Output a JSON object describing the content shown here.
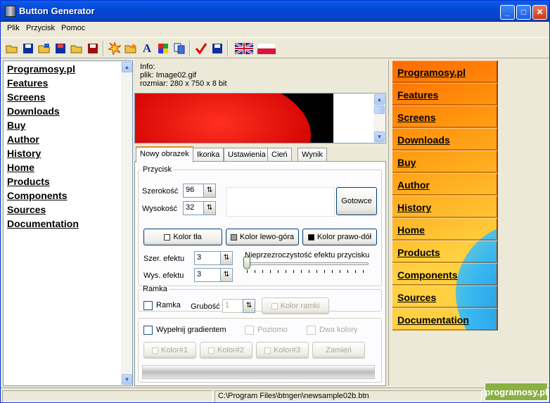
{
  "window": {
    "title": "Button Generator"
  },
  "menu": [
    "Plik",
    "Przycisk",
    "Pomoc"
  ],
  "links": [
    "Programosy.pl",
    "Features",
    "Screens",
    "Downloads",
    "Buy",
    "Author",
    "History",
    "Home",
    "Products",
    "Components",
    "Sources",
    "Documentation"
  ],
  "info": {
    "line1": "Info:",
    "line2": "plik: Image02.gif",
    "line3": "rozmiar: 280 x 750 x 8 bit"
  },
  "tabs": [
    "Nowy obrazek",
    "Ikonka",
    "Ustawienia",
    "Cień",
    "Wynik"
  ],
  "przycisk": {
    "legend": "Przycisk",
    "width_label": "Szerokość",
    "width_value": "96",
    "height_label": "Wysokość",
    "height_value": "32",
    "ready_btn": "Gotowce",
    "bg_color_btn": "Kolor tła",
    "tl_color_btn": "Kolor lewo-góra",
    "br_color_btn": "Kolor prawo-dół",
    "effect_w_label": "Szer. efektu",
    "effect_w_value": "3",
    "effect_h_label": "Wys. efektu",
    "effect_h_value": "3",
    "opacity_label": "Nieprzezroczystość efektu przycisku"
  },
  "ramka": {
    "legend": "Ramka",
    "chk_label": "Ramka",
    "thickness_label": "Grubość",
    "thickness_value": "1",
    "color_btn": "Kolor ramki"
  },
  "gradient": {
    "fill_label": "Wypełnij gradientem",
    "horiz_label": "Poziomo",
    "two_label": "Dwa kolory",
    "c1": "Kolor#1",
    "c2": "Kolor#2",
    "c3": "Kolor#3",
    "swap": "Zamień"
  },
  "status": {
    "path": "C:\\Program Files\\btngen\\newsample02b.btn"
  },
  "watermark": "programosy.pl",
  "colors": {
    "title": "#0648d6",
    "bg_swatch": "#ffffff",
    "tl_swatch": "#a0a0a0",
    "br_swatch": "#000000"
  }
}
